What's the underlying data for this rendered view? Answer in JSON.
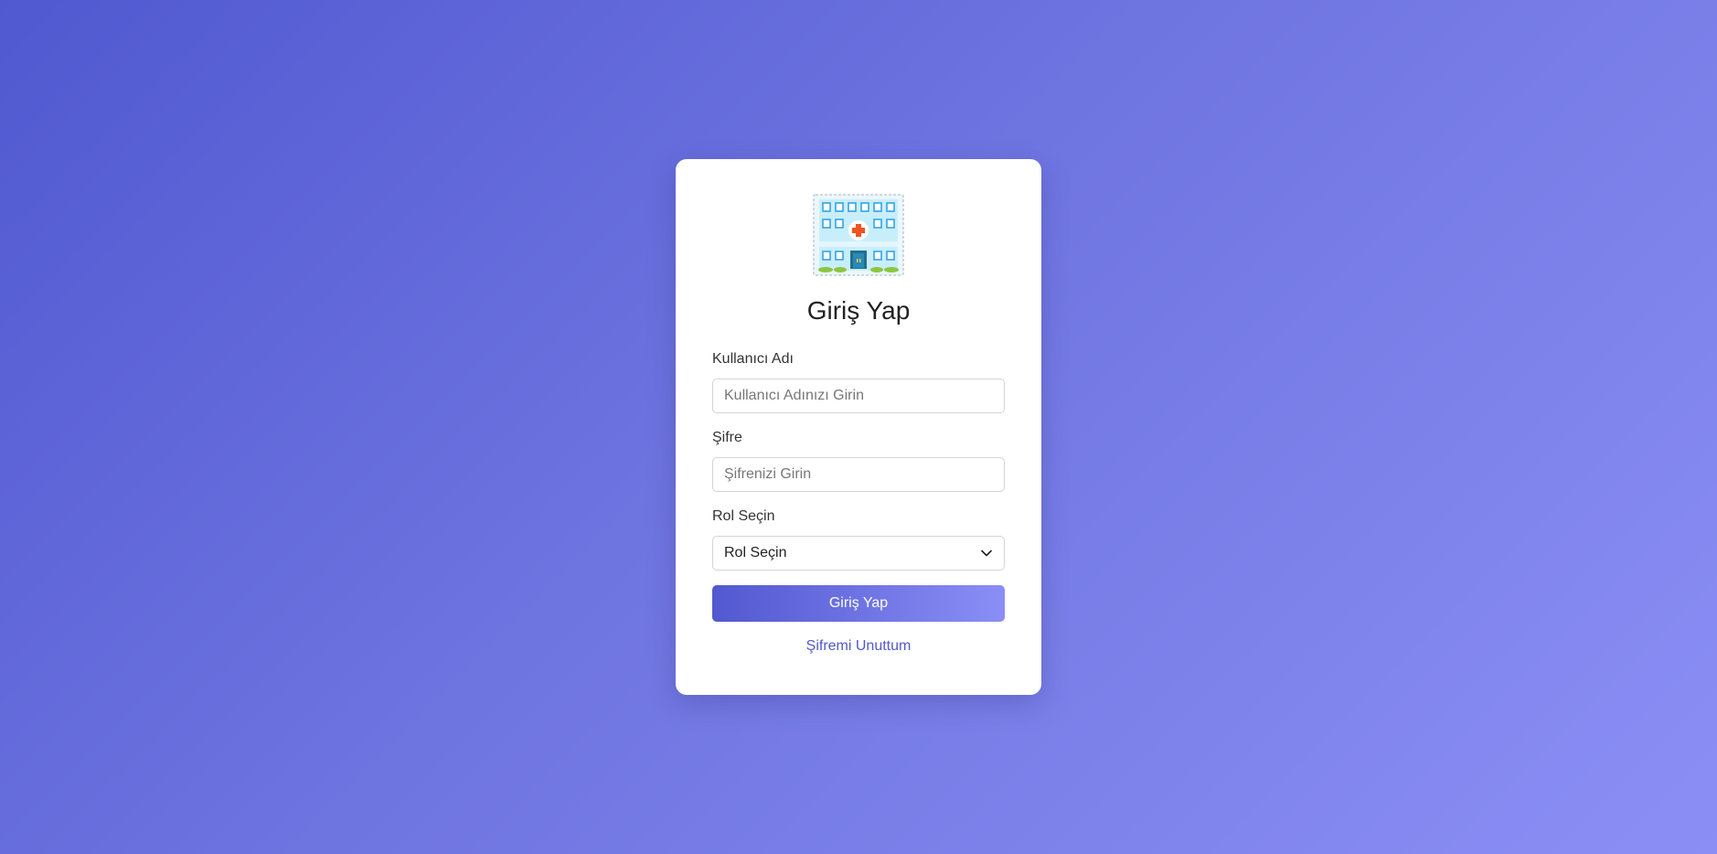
{
  "login": {
    "title": "Giriş Yap",
    "username_label": "Kullanıcı Adı",
    "username_placeholder": "Kullanıcı Adınızı Girin",
    "password_label": "Şifre",
    "password_placeholder": "Şifrenizi Girin",
    "role_label": "Rol Seçin",
    "role_selected": "Rol Seçin",
    "submit_label": "Giriş Yap",
    "forgot_label": "Şifremi Unuttum"
  },
  "icons": {
    "logo": "hospital-icon",
    "select_arrow": "chevron-down-icon"
  },
  "colors": {
    "background_start": "#5159d1",
    "background_end": "#8b8ff5",
    "button_start": "#5258d0",
    "button_end": "#8a8ef6",
    "link": "#5159c8"
  }
}
